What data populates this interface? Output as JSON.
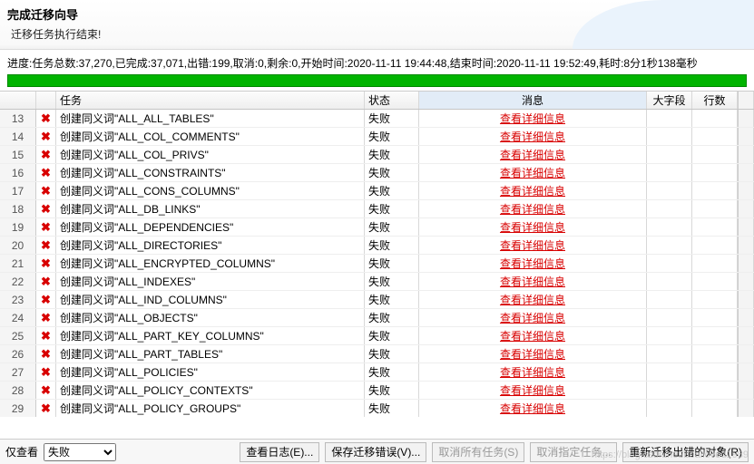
{
  "header": {
    "title": "完成迁移向导",
    "subtitle": "迁移任务执行结束!"
  },
  "progress": {
    "text": "进度:任务总数:37,270,已完成:37,071,出错:199,取消:0,剩余:0,开始时间:2020-11-11 19:44:48,结束时间:2020-11-11 19:52:49,耗时:8分1秒138毫秒"
  },
  "columns": {
    "task": "任务",
    "status": "状态",
    "message": "消息",
    "bigfield": "大字段",
    "rows": "行数"
  },
  "status_fail": "失败",
  "detail_label": "查看详细信息",
  "task_prefix": "创建同义词",
  "rows": [
    {
      "num": 13,
      "name": "ALL_ALL_TABLES"
    },
    {
      "num": 14,
      "name": "ALL_COL_COMMENTS"
    },
    {
      "num": 15,
      "name": "ALL_COL_PRIVS"
    },
    {
      "num": 16,
      "name": "ALL_CONSTRAINTS"
    },
    {
      "num": 17,
      "name": "ALL_CONS_COLUMNS"
    },
    {
      "num": 18,
      "name": "ALL_DB_LINKS"
    },
    {
      "num": 19,
      "name": "ALL_DEPENDENCIES"
    },
    {
      "num": 20,
      "name": "ALL_DIRECTORIES"
    },
    {
      "num": 21,
      "name": "ALL_ENCRYPTED_COLUMNS"
    },
    {
      "num": 22,
      "name": "ALL_INDEXES"
    },
    {
      "num": 23,
      "name": "ALL_IND_COLUMNS"
    },
    {
      "num": 24,
      "name": "ALL_OBJECTS"
    },
    {
      "num": 25,
      "name": "ALL_PART_KEY_COLUMNS"
    },
    {
      "num": 26,
      "name": "ALL_PART_TABLES"
    },
    {
      "num": 27,
      "name": "ALL_POLICIES"
    },
    {
      "num": 28,
      "name": "ALL_POLICY_CONTEXTS"
    },
    {
      "num": 29,
      "name": "ALL_POLICY_GROUPS"
    }
  ],
  "footer": {
    "filter_label": "仅查看",
    "filter_value": "失败",
    "view_log": "查看日志(E)...",
    "save_errors": "保存迁移错误(V)...",
    "cancel_all": "取消所有任务(S)",
    "cancel_sel": "取消指定任务...",
    "retry": "重新迁移出错的对象(R)"
  },
  "watermark": "https://blog.csdn.net/bealloved1989"
}
